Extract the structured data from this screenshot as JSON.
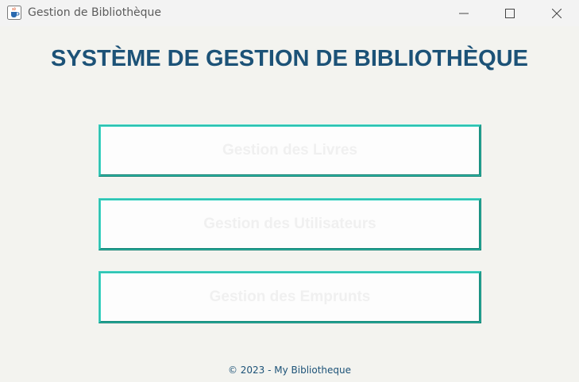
{
  "window": {
    "title": "Gestion de Bibliothèque",
    "icon": "java-cup-icon",
    "controls": {
      "minimize": "minimize-icon",
      "maximize": "maximize-icon",
      "close": "close-icon"
    }
  },
  "main": {
    "heading": "SYSTÈME DE GESTION DE BIBLIOTHÈQUE",
    "buttons": [
      {
        "label": "Gestion des Livres"
      },
      {
        "label": "Gestion des Utilisateurs"
      },
      {
        "label": "Gestion des Emprunts"
      }
    ]
  },
  "footer": {
    "text": "© 2023 - My Bibliotheque"
  },
  "colors": {
    "heading": "#1c5277",
    "button_border_light": "#3fd6c6",
    "button_border_dark": "#0f7f70",
    "button_background": "#fdfdfd",
    "window_background": "#f3f3ef"
  }
}
